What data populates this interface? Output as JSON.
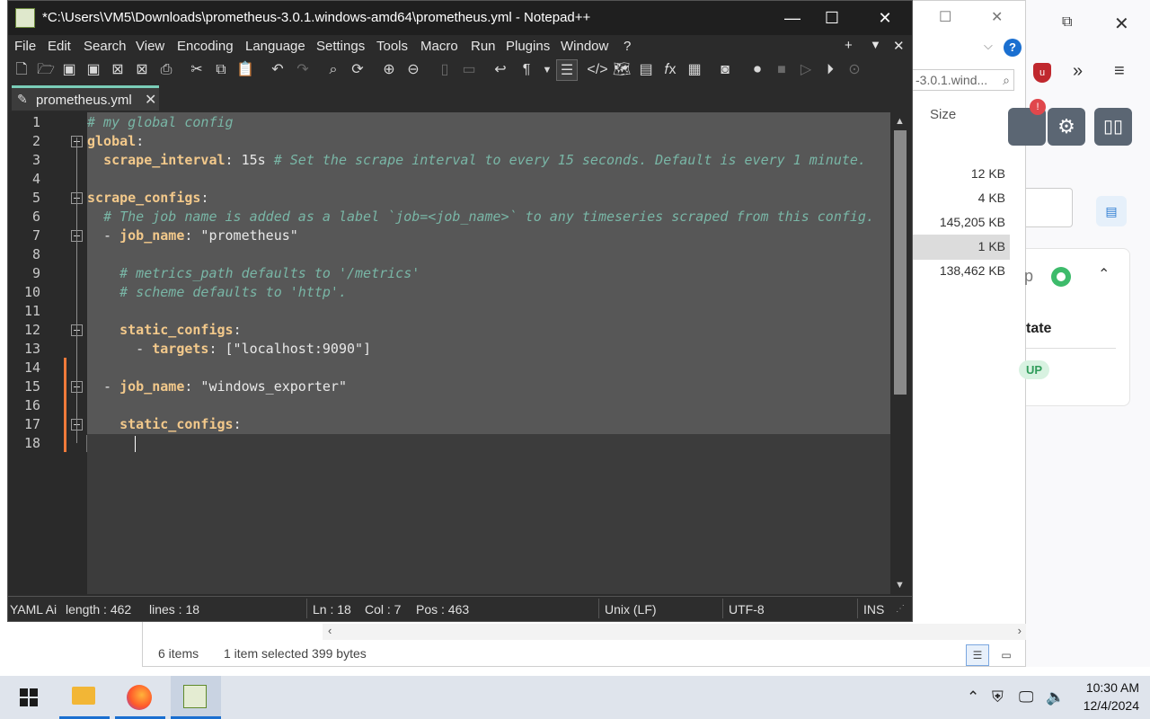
{
  "notepad": {
    "title": "*C:\\Users\\VM5\\Downloads\\prometheus-3.0.1.windows-amd64\\prometheus.yml - Notepad++",
    "menu": [
      "File",
      "Edit",
      "Search",
      "View",
      "Encoding",
      "Language",
      "Settings",
      "Tools",
      "Macro",
      "Run",
      "Plugins",
      "Window",
      "?"
    ],
    "menu_right": [
      "+",
      "▼",
      "✕"
    ],
    "tab_label": "prometheus.yml",
    "line_numbers": [
      "1",
      "2",
      "3",
      "4",
      "5",
      "6",
      "7",
      "8",
      "9",
      "10",
      "11",
      "12",
      "13",
      "14",
      "15",
      "16",
      "17",
      "18"
    ],
    "code": {
      "l1_comment": "# my global config",
      "l2_key": "global",
      "l3_key": "scrape_interval",
      "l3_value": " 15s ",
      "l3_comment": "# Set the scrape interval to every 15 seconds. Default is every 1 minute.",
      "l5_key": "scrape_configs",
      "l6_comment": "# The job name is added as a label `job=<job_name>` to any timeseries scraped from this config.",
      "l7_dash": "  - ",
      "l7_key": "job_name",
      "l7_value": " \"prometheus\"",
      "l9_comment": "# metrics_path defaults to '/metrics'",
      "l10_comment": "# scheme defaults to 'http'.",
      "l12_key": "static_configs",
      "l13_dash": "      - ",
      "l13_key": "targets",
      "l13_value": " [\"localhost:9090\"]",
      "l15_dash": "  - ",
      "l15_key": "job_name",
      "l15_value": " \"windows_exporter\"",
      "l17_key": "static_configs"
    },
    "status": {
      "language": "YAML Ai",
      "length": "length : 462",
      "lines": "lines : 18",
      "ln": "Ln : 18",
      "col": "Col : 7",
      "pos": "Pos : 463",
      "eol": "Unix (LF)",
      "encoding": "UTF-8",
      "mode": "INS"
    }
  },
  "explorer": {
    "search_text": "-3.0.1.wind...",
    "size_header": "Size",
    "sizes": [
      "12 KB",
      "4 KB",
      "145,205 KB",
      "1 KB",
      "138,462 KB"
    ],
    "status_items": "6 items",
    "status_selected": "1 item selected  399 bytes"
  },
  "browser": {
    "card_text_1": "p",
    "card_text_2": "tate",
    "badge": "UP",
    "notification": "!"
  },
  "taskbar": {
    "time": "10:30 AM",
    "date": "12/4/2024"
  },
  "colors": {
    "comment": "#79b6a6",
    "key": "#f3c98b",
    "selection": "#575757",
    "modified_marker": "#f07a3a",
    "tab_accent": "#7acdb8"
  }
}
